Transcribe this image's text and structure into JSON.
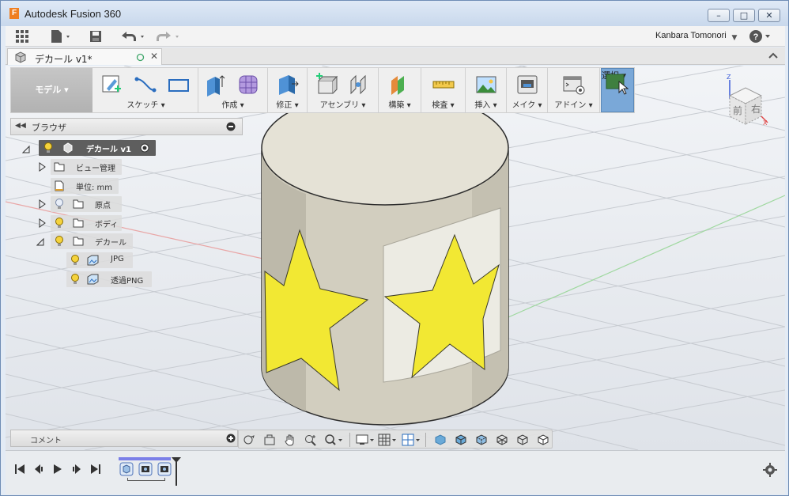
{
  "window": {
    "logo_letter": "F",
    "title": "Autodesk Fusion 360",
    "minimize_glyph": "–",
    "maximize_glyph": "□",
    "close_glyph": "✕"
  },
  "appbar": {
    "user_name": "Kanbara Tomonori",
    "help_glyph": "?"
  },
  "tab": {
    "label": "デカール v1*",
    "close_glyph": "✕"
  },
  "toolbar": {
    "mode_label": "モデル",
    "groups": [
      {
        "label": "スケッチ"
      },
      {
        "label": "作成"
      },
      {
        "label": "修正"
      },
      {
        "label": "アセンブリ"
      },
      {
        "label": "構築"
      },
      {
        "label": "検査"
      },
      {
        "label": "挿入"
      },
      {
        "label": "メイク"
      },
      {
        "label": "アドイン"
      },
      {
        "label": "選択"
      }
    ]
  },
  "browser": {
    "title": "ブラウザ",
    "root": "デカール v1",
    "items": [
      {
        "label": "ビュー管理"
      },
      {
        "label": "単位: mm"
      },
      {
        "label": "原点"
      },
      {
        "label": "ボディ"
      },
      {
        "label": "デカール"
      },
      {
        "label": "JPG"
      },
      {
        "label": "透過PNG"
      }
    ]
  },
  "viewcube": {
    "front": "前",
    "right": "右",
    "axis_z": "Z",
    "axis_x": "X"
  },
  "comment": {
    "label": "コメント"
  },
  "colors": {
    "star": "#f2e833",
    "cylinder": "#d6d2c6",
    "selection_active": "#7aa8d8"
  }
}
